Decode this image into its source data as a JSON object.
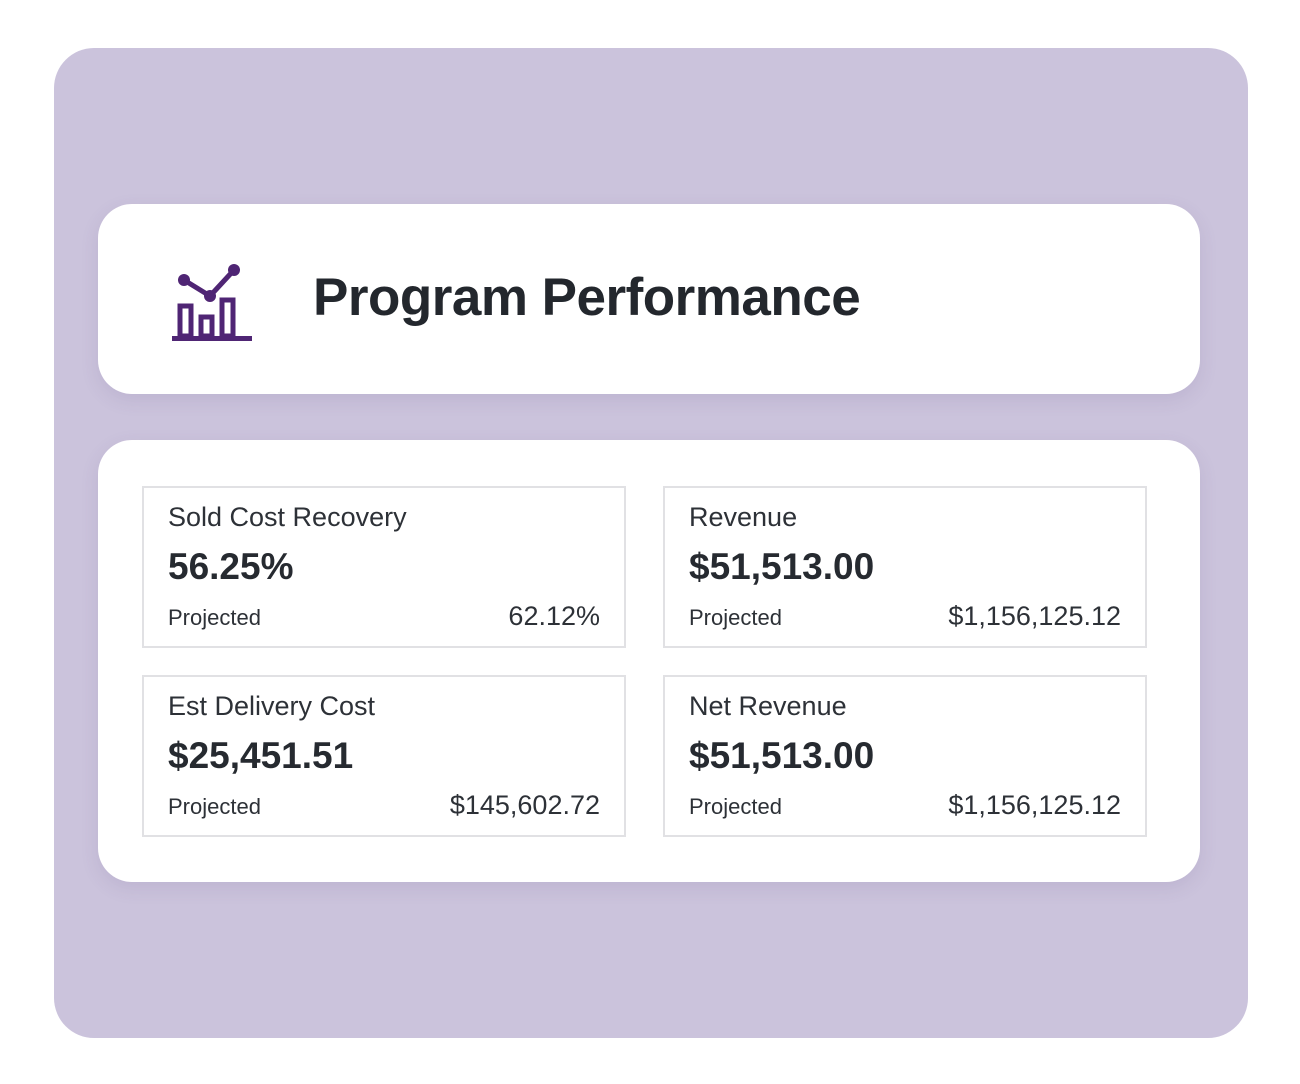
{
  "header": {
    "title": "Program Performance",
    "icon": "analytics-chart-icon",
    "accent_color": "#4f2574"
  },
  "metrics": [
    {
      "label": "Sold Cost Recovery",
      "value": "56.25%",
      "projected_label": "Projected",
      "projected_value": "62.12%"
    },
    {
      "label": "Revenue",
      "value": "$51,513.00",
      "projected_label": "Projected",
      "projected_value": "$1,156,125.12"
    },
    {
      "label": "Est Delivery Cost",
      "value": "$25,451.51",
      "projected_label": "Projected",
      "projected_value": "$145,602.72"
    },
    {
      "label": "Net Revenue",
      "value": "$51,513.00",
      "projected_label": "Projected",
      "projected_value": "$1,156,125.12"
    }
  ],
  "colors": {
    "background_frame": "#cbc3dc",
    "card": "#ffffff",
    "text": "#262a30",
    "border": "#e1e1e4"
  }
}
